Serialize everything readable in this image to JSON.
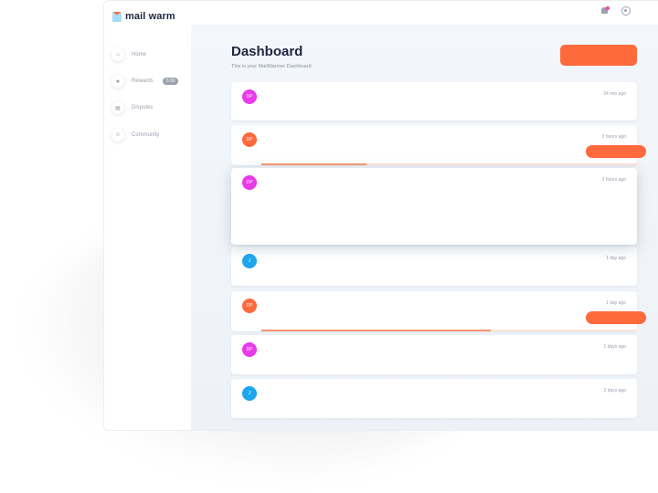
{
  "app": {
    "logo_text": "mail warm",
    "icons": {
      "notifications": "bell-icon",
      "account": "user-circle-icon"
    }
  },
  "sidebar": {
    "items": [
      {
        "label": "Home",
        "icon": "home-icon",
        "glyph": "⌂"
      },
      {
        "label": "Rewards",
        "icon": "star-icon",
        "glyph": "★",
        "badge": "0.00"
      },
      {
        "label": "Disputes",
        "icon": "document-icon",
        "glyph": "▤"
      },
      {
        "label": "Community",
        "icon": "people-icon",
        "glyph": "☺"
      }
    ]
  },
  "header": {
    "title": "Dashboard",
    "subtitle": "This is your MailWarmer Dashboard"
  },
  "colors": {
    "accent": "#ff6a3d",
    "magenta": "#e93ae9",
    "blue": "#1ea6ec",
    "orange": "#ff6a3d",
    "progress": "#f7956f"
  },
  "feed": [
    {
      "initials": "DP",
      "avatar_color": "#e93ae9",
      "time": "34 min ago"
    },
    {
      "initials": "DP",
      "avatar_color": "#ff6a3d",
      "time": "2 hours ago",
      "progress": 0.28,
      "has_action": true
    },
    {
      "initials": "DP",
      "avatar_color": "#e93ae9",
      "time": "3 hours ago"
    },
    {
      "initials": "J",
      "avatar_color": "#1ea6ec",
      "time": "1 day ago"
    },
    {
      "initials": "DP",
      "avatar_color": "#ff6a3d",
      "time": "1 day ago",
      "progress": 0.61,
      "has_action": true
    },
    {
      "initials": "DP",
      "avatar_color": "#e93ae9",
      "time": "1 days ago"
    },
    {
      "initials": "J",
      "avatar_color": "#1ea6ec",
      "time": "2 days ago"
    }
  ]
}
